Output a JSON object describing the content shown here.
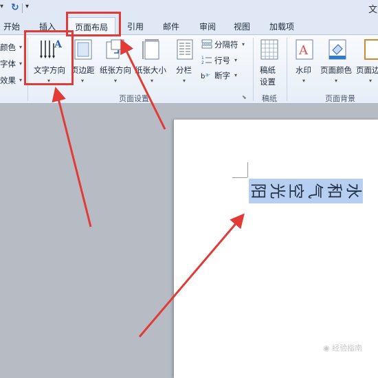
{
  "quick_access": {
    "title_fragment": "文"
  },
  "tabs": [
    "开始",
    "插入",
    "页面布局",
    "引用",
    "邮件",
    "审阅",
    "视图",
    "加载项"
  ],
  "active_tab": "页面布局",
  "ribbon": {
    "theme_group": {
      "colors": "颜色",
      "fonts": "字体",
      "effects": "效果"
    },
    "page_setup": {
      "label": "页面设置",
      "text_direction": "文字方向",
      "margins": "页边距",
      "orientation": "纸张方向",
      "size": "纸张大小",
      "columns": "分栏",
      "breaks": "分隔符",
      "line_numbers": "行号",
      "hyphenation": "断字"
    },
    "draft_paper": {
      "label": "稿纸",
      "button_line1": "稿纸",
      "button_line2": "设置"
    },
    "page_background": {
      "label": "页面背景",
      "watermark": "水印",
      "page_color": "页面颜色",
      "page_border": "页面边"
    }
  },
  "document": {
    "text": [
      "阳",
      "光",
      "空",
      "气",
      "和",
      "水"
    ]
  },
  "watermark_text": "经验指南",
  "colors": {
    "highlight_red": "#e23a36",
    "selection_blue": "#b6cff0"
  }
}
